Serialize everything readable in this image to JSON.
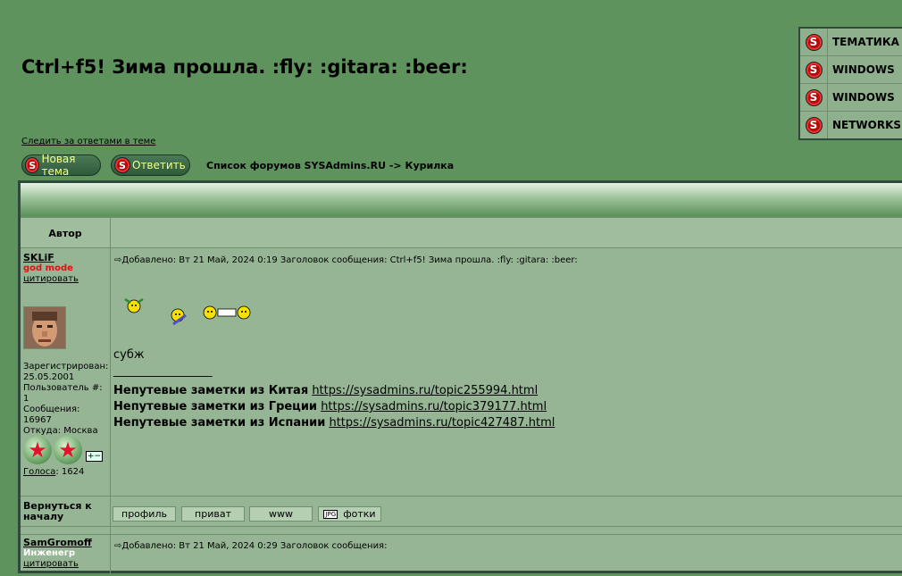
{
  "topic": {
    "title": "Ctrl+f5! Зима прошла. :fly: :gitara: :beer:",
    "watch_link": "Следить за ответами в теме"
  },
  "side_menu": [
    {
      "label": "ТЕМАТИКА",
      "icon": "s-logo-icon"
    },
    {
      "label": "WINDOWS",
      "icon": "s-logo-icon"
    },
    {
      "label": "WINDOWS",
      "icon": "s-logo-icon"
    },
    {
      "label": "NETWORKS",
      "icon": "s-logo-icon"
    }
  ],
  "buttons": {
    "new_topic": "Новая тема",
    "reply": "Ответить"
  },
  "breadcrumb": {
    "forums": "Список форумов SYSAdmins.RU",
    "sep": "->",
    "current": "Курилка"
  },
  "table": {
    "author_header": "Автор"
  },
  "posts": [
    {
      "author": "SKLiF",
      "rank": "god mode",
      "quote": "цитировать",
      "registered_label": "Зарегистрирован:",
      "registered": "25.05.2001",
      "user_no_label": "Пользователь #:",
      "user_no": "1",
      "messages_label": "Сообщения:",
      "messages": "16967",
      "from_label": "Откуда:",
      "from": "Москва",
      "votes_label": "Голоса",
      "votes": ": 1624",
      "header": "Добавлено: Вт 21 Май, 2024 0:19    Заголовок сообщения: Ctrl+f5! Зима прошла. :fly: :gitara: :beer:",
      "body_text": "субж",
      "signature_sep": "_________________",
      "signature": [
        {
          "text": "Непутевые заметки из Китая",
          "link": "https://sysadmins.ru/topic255994.html"
        },
        {
          "text": "Непутевые заметки из Греции",
          "link": "https://sysadmins.ru/topic379177.html"
        },
        {
          "text": "Непутевые заметки из Испании",
          "link": "https://sysadmins.ru/topic427487.html"
        }
      ],
      "back_to_top": "Вернуться к началу",
      "actions": {
        "profile": "профиль",
        "private": "приват",
        "www": "www",
        "photos": "фотки"
      }
    },
    {
      "author": "SamGromoff",
      "rank": "Инженегр",
      "quote": "цитировать",
      "header": "Добавлено: Вт 21 Май, 2024 0:29    Заголовок сообщения:"
    }
  ]
}
